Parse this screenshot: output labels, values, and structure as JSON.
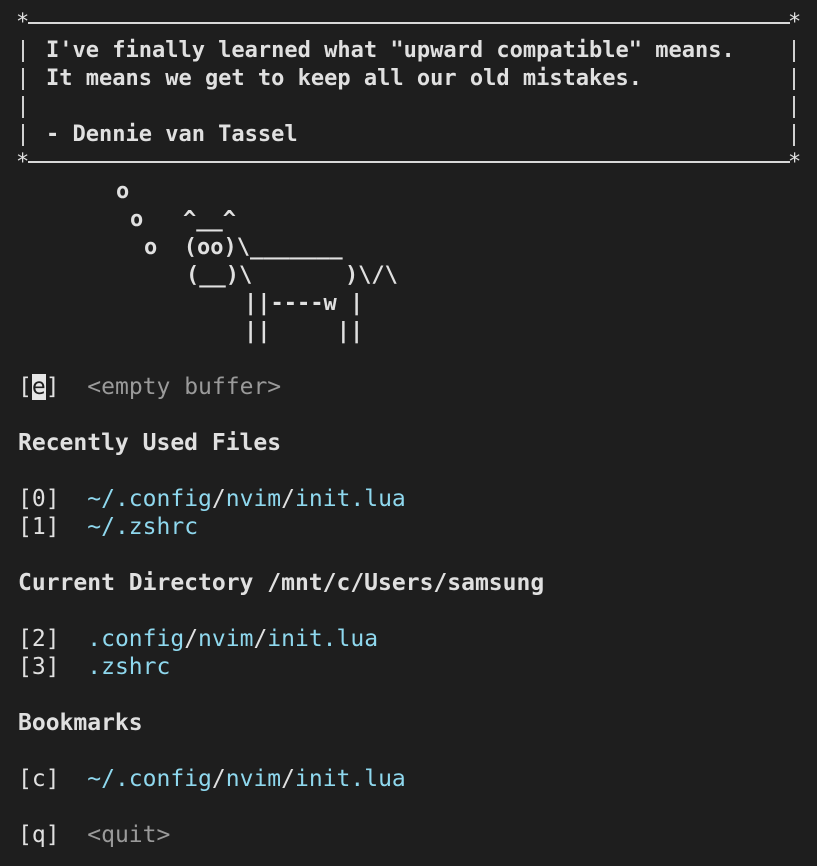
{
  "quote": {
    "lines": [
      "I've finally learned what \"upward compatible\" means.",
      "It means we get to keep all our old mistakes.",
      "",
      "- Dennie van Tassel"
    ],
    "border_corner": "*",
    "border_side": "|"
  },
  "cow": {
    "thought1": "o",
    "thought2": "o   ^__^",
    "thought3": "o  (oo)\\_______",
    "body1": "(__)\\       )\\/\\",
    "body2": "||----w |",
    "body3": "||     ||"
  },
  "empty_buffer": {
    "key_open": "[",
    "key": "e",
    "key_close": "]",
    "label": "<empty buffer>"
  },
  "recent": {
    "header": "Recently Used Files",
    "items": [
      {
        "key": "[0]",
        "prefix": "~/",
        "dir1": ".config",
        "dir2": "nvim",
        "file": "init.lua"
      },
      {
        "key": "[1]",
        "prefix": "~/",
        "file": ".zshrc"
      }
    ]
  },
  "current_dir": {
    "header": "Current Directory /mnt/c/Users/samsung",
    "items": [
      {
        "key": "[2]",
        "dir1": ".config",
        "dir2": "nvim",
        "file": "init.lua"
      },
      {
        "key": "[3]",
        "file": ".zshrc"
      }
    ]
  },
  "bookmarks": {
    "header": "Bookmarks",
    "items": [
      {
        "key": "[c]",
        "prefix": "~/",
        "dir1": ".config",
        "dir2": "nvim",
        "file": "init.lua"
      }
    ]
  },
  "quit": {
    "key": "[q]",
    "label": "<quit>"
  },
  "colors": {
    "background": "#1e1e1e",
    "text": "#e0e0e0",
    "path": "#8fd8ee",
    "dim": "#9a9a9a"
  }
}
